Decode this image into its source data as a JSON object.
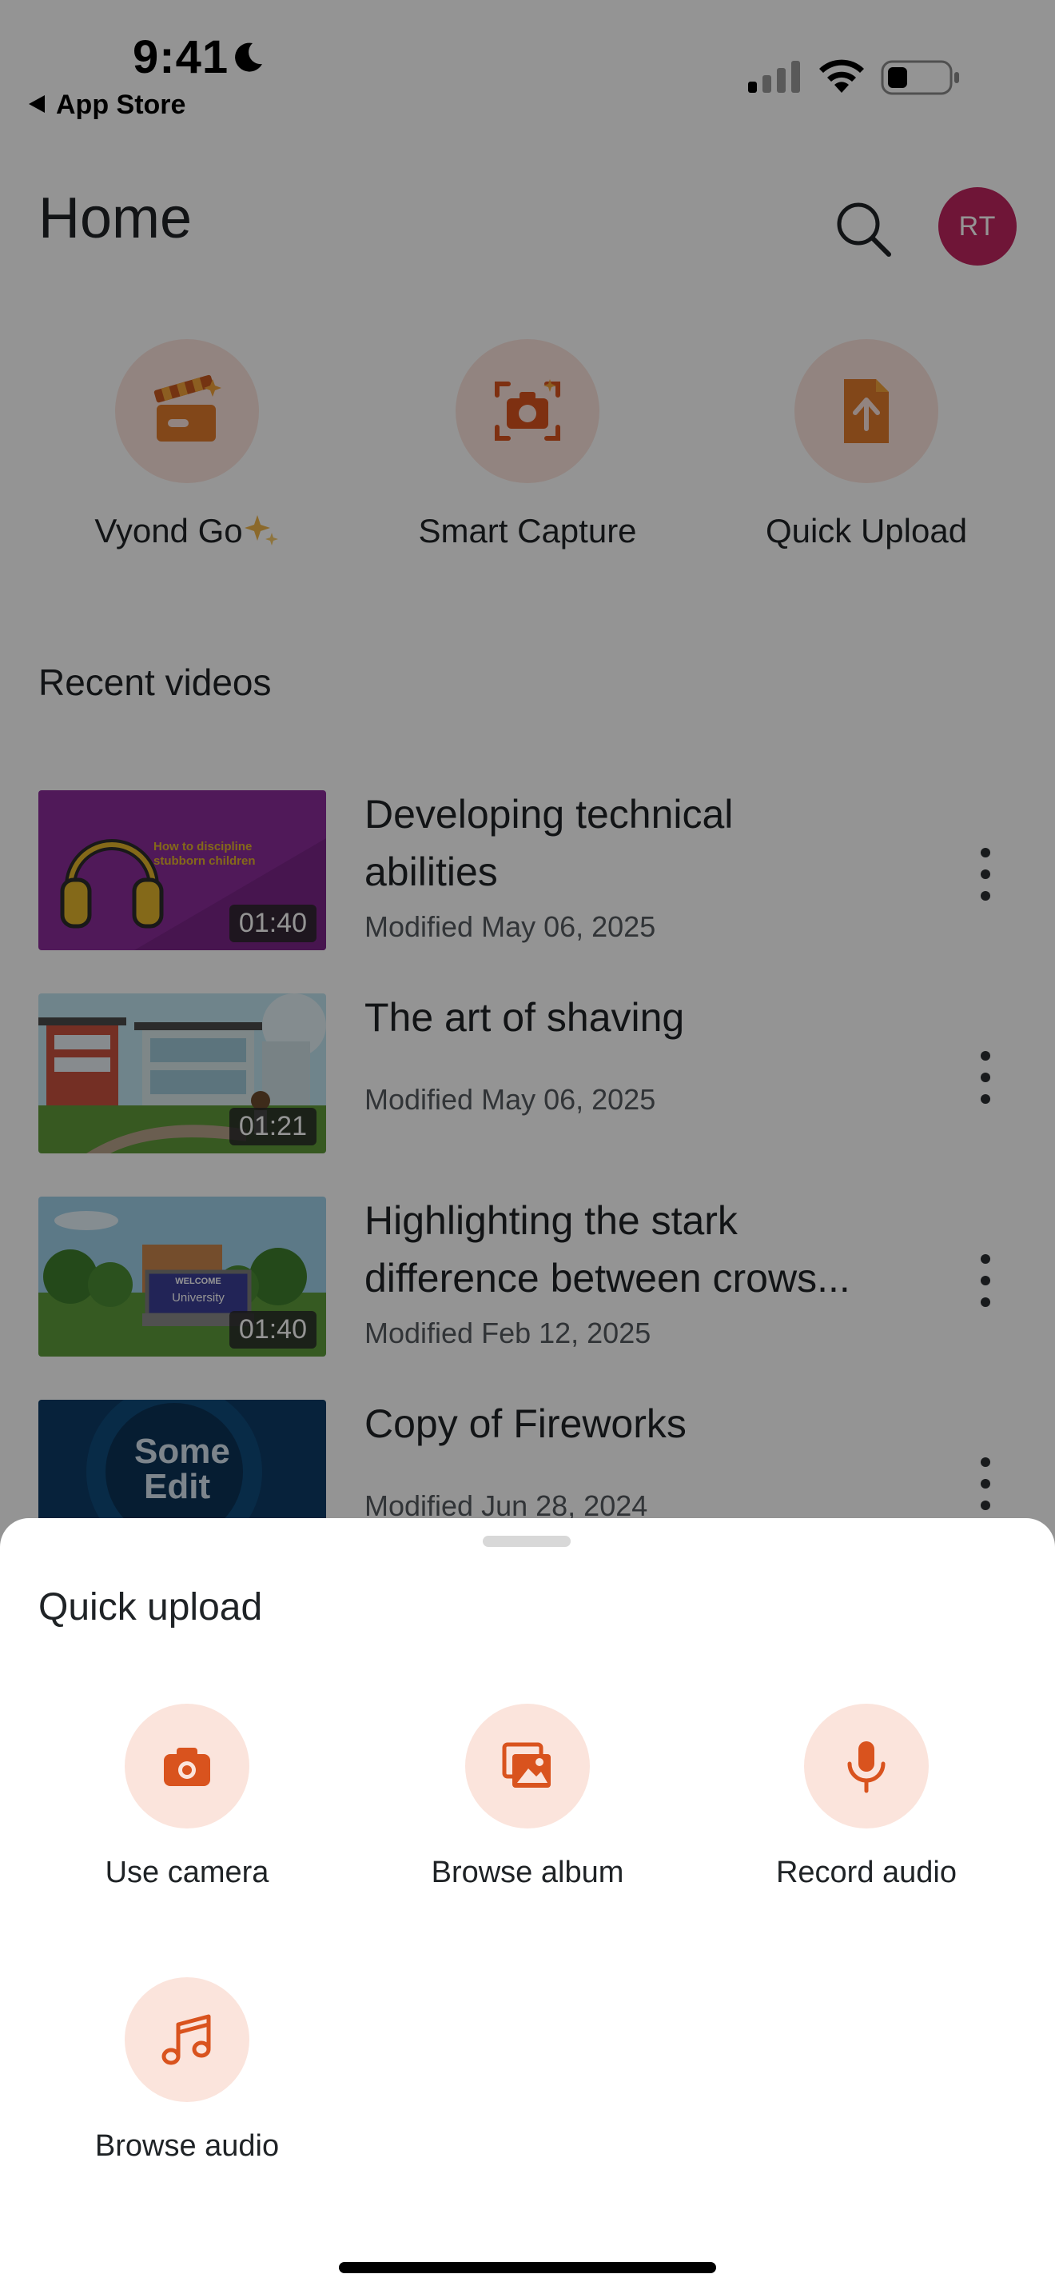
{
  "status_bar": {
    "time": "9:41",
    "back_label": "App Store",
    "moon_icon": "moon-icon",
    "signal_icon": "cellular-signal-icon",
    "wifi_icon": "wifi-icon",
    "battery_icon": "battery-icon"
  },
  "header": {
    "title": "Home",
    "search_icon": "search-icon",
    "avatar_initials": "RT",
    "avatar_color": "#c0255f"
  },
  "quick_actions": [
    {
      "label": "Vyond Go",
      "icon": "clapperboard-icon",
      "sparkle_icon": "sparkles-icon"
    },
    {
      "label": "Smart Capture",
      "icon": "camera-capture-icon"
    },
    {
      "label": "Quick Upload",
      "icon": "upload-file-icon"
    }
  ],
  "recent": {
    "title": "Recent videos",
    "videos": [
      {
        "title_line1": "Developing technical",
        "title_line2": "abilities",
        "meta": "Modified May 06, 2025",
        "duration": "01:40",
        "thumb_text": "How to discipline stubborn children"
      },
      {
        "title_line1": "The art of shaving",
        "title_line2": "",
        "meta": "Modified May 06, 2025",
        "duration": "01:21"
      },
      {
        "title_line1": "Highlighting the stark",
        "title_line2": "difference between crows...",
        "meta": "Modified Feb 12, 2025",
        "duration": "01:40",
        "thumb_sign_top": "WELCOME",
        "thumb_sign_bottom": "University"
      },
      {
        "title_line1": "Copy of Fireworks",
        "title_line2": "",
        "meta": "Modified Jun 28, 2024",
        "thumb_text_1": "Some",
        "thumb_text_2": "Edit"
      }
    ]
  },
  "sheet": {
    "title": "Quick upload",
    "actions": [
      {
        "label": "Use camera",
        "icon": "camera-icon"
      },
      {
        "label": "Browse album",
        "icon": "photo-album-icon"
      },
      {
        "label": "Record audio",
        "icon": "microphone-icon"
      },
      {
        "label": "Browse audio",
        "icon": "music-note-icon"
      }
    ]
  },
  "colors": {
    "accent": "#d9531e",
    "icon_bg": "#fbe4dc",
    "text": "#1f2326",
    "muted": "#555a5f"
  }
}
